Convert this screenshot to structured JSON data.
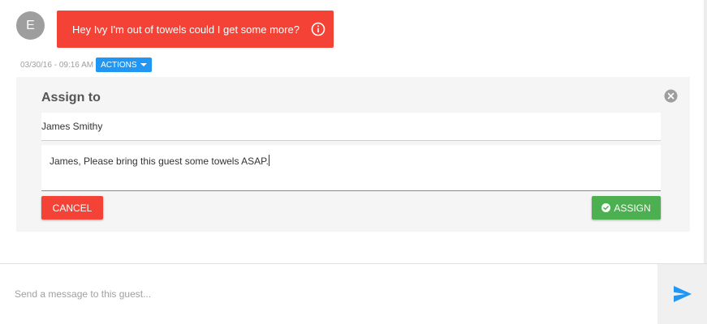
{
  "message": {
    "avatar_letter": "E",
    "text": "Hey Ivy I'm out of towels could I get some more?",
    "icon": "info-circle-icon",
    "timestamp": "03/30/16 - 09:16 AM",
    "actions_label": "ACTIONS"
  },
  "assign_panel": {
    "title": "Assign to",
    "assignee": "James Smithy",
    "note": "James, Please bring this guest some towels ASAP.",
    "cancel_label": "CANCEL",
    "assign_label": "ASSIGN"
  },
  "composer": {
    "placeholder": "Send a message to this guest..."
  },
  "colors": {
    "message_bubble": "#f44336",
    "actions": "#2196f3",
    "cancel": "#f44336",
    "assign": "#4caf50",
    "send": "#2196f3"
  }
}
